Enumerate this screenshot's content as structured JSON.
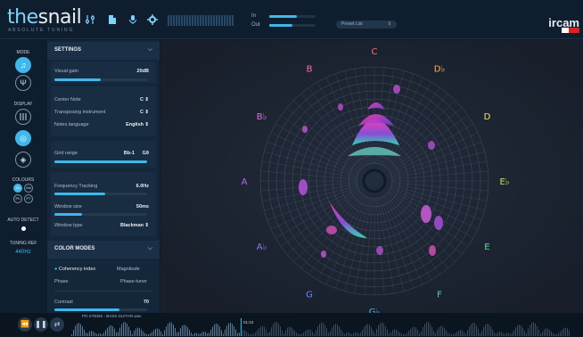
{
  "app": {
    "logo_main": "the",
    "logo_rest": "snail",
    "logo_sub": "ABSOLUTE TUNING",
    "brand": "ircam",
    "colors": {
      "accent": "#3fb8ea",
      "background": "#0d1b2a",
      "panel": "#13263a"
    }
  },
  "toolbar": {
    "icons": [
      "sliders-icon",
      "document-icon",
      "microphone-icon",
      "gear-icon"
    ],
    "in_label": "In",
    "out_label": "Out",
    "in_level": 0.6,
    "out_level": 0.5,
    "preset_label": "Preset List",
    "preset_arrow": "⇕"
  },
  "rail": {
    "mode_label": "MODE",
    "display_label": "DISPLAY",
    "colours_label": "COLOURS",
    "colour_buttons": [
      "Co",
      "Ma",
      "Ph",
      "PT"
    ],
    "auto_detect_label": "AUTO DETECT",
    "tuning_ref_label": "TUNING REF",
    "tuning_ref_value": "440Hz"
  },
  "settings": {
    "title": "SETTINGS",
    "chevron": "⌵",
    "visual_gain": {
      "label": "Visual gain",
      "value": "20dB",
      "level": 0.5
    },
    "center_note": {
      "label": "Center Note",
      "value": "C",
      "arrow": "⇕"
    },
    "transposing": {
      "label": "Transposing instrument",
      "value": "C",
      "arrow": "⇕"
    },
    "notes_language": {
      "label": "Notes language",
      "value": "English",
      "arrow": "⇕"
    },
    "grid_range": {
      "label": "Grid range",
      "low": "Bb-1",
      "high": "G9",
      "level": 1.0
    },
    "frequency_tracking": {
      "label": "Frequency Tracking",
      "value": "6.0Hz",
      "level": 0.55
    },
    "window_size": {
      "label": "Window size",
      "value": "50ms",
      "level": 0.3
    },
    "window_type": {
      "label": "Window type",
      "value": "Blackman",
      "arrow": "⇕"
    }
  },
  "color_modes": {
    "title": "COLOR MODES",
    "chevron": "⌵",
    "options": [
      {
        "label": "Coherency index",
        "selected": true
      },
      {
        "label": "Magnitude",
        "selected": false
      },
      {
        "label": "Phase",
        "selected": false
      },
      {
        "label": "Phase-tuner",
        "selected": false
      }
    ],
    "contrast": {
      "label": "Contrast",
      "value": "70",
      "level": 0.7
    }
  },
  "notes": [
    {
      "name": "C",
      "color": "#ff6b6b"
    },
    {
      "name": "D♭",
      "color": "#ffb347"
    },
    {
      "name": "D",
      "color": "#f2e65c"
    },
    {
      "name": "E♭",
      "color": "#b8ee5a"
    },
    {
      "name": "E",
      "color": "#58e08f"
    },
    {
      "name": "F",
      "color": "#43d6c8"
    },
    {
      "name": "G♭",
      "color": "#4fb4f0"
    },
    {
      "name": "G",
      "color": "#6a8cf5"
    },
    {
      "name": "A♭",
      "color": "#8f78f0"
    },
    {
      "name": "A",
      "color": "#b86cf0"
    },
    {
      "name": "B♭",
      "color": "#e66ee0"
    },
    {
      "name": "B",
      "color": "#ff6fa8"
    }
  ],
  "transport": {
    "rewind_icon": "⏪",
    "pause_icon": "❚❚",
    "loop_icon": "⇄",
    "filename": "PO STEMS - BASS GUITAR.wav",
    "timecode": "01:24"
  }
}
